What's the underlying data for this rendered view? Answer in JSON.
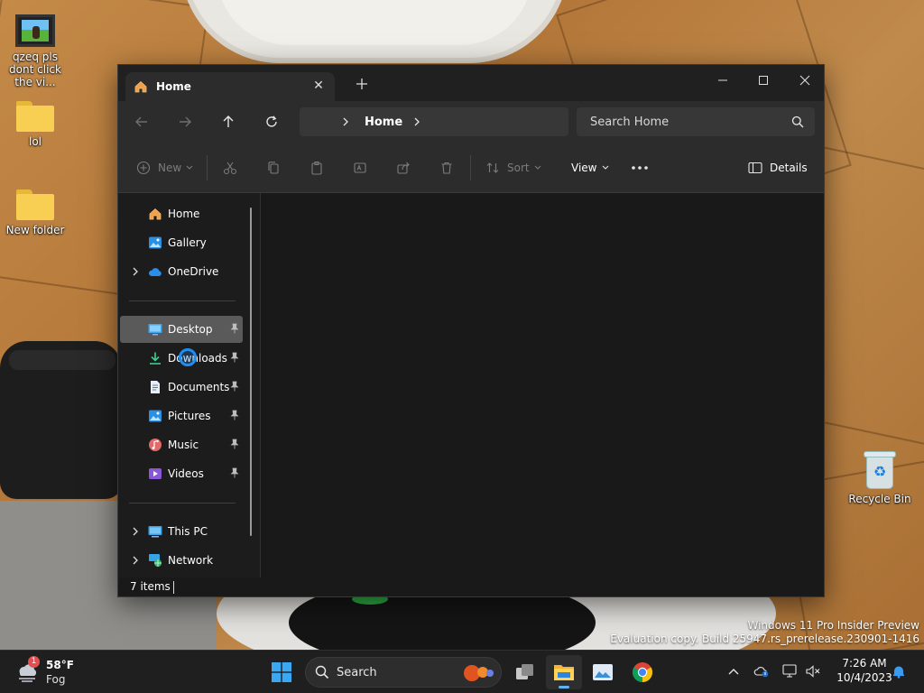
{
  "desktop": {
    "icons": [
      {
        "label": "qzeq pls dont click the vi..."
      },
      {
        "label": "lol"
      },
      {
        "label": "New folder"
      },
      {
        "label": "Recycle Bin"
      }
    ],
    "watermark": {
      "line1": "Windows 11 Pro Insider Preview",
      "line2": "Evaluation copy. Build 25947.rs_prerelease.230901-1416"
    }
  },
  "explorer": {
    "tab": {
      "label": "Home"
    },
    "window_controls": {
      "minimize": "minimize-icon",
      "maximize": "maximize-icon",
      "close": "close-icon"
    },
    "address": {
      "crumb": "Home"
    },
    "search": {
      "placeholder": "Search Home"
    },
    "commands": {
      "new_label": "New",
      "sort_label": "Sort",
      "view_label": "View",
      "details_label": "Details"
    },
    "nav": {
      "items": [
        {
          "label": "Home"
        },
        {
          "label": "Gallery"
        },
        {
          "label": "OneDrive"
        },
        {
          "label": "Desktop"
        },
        {
          "label": "Downloads"
        },
        {
          "label": "Documents"
        },
        {
          "label": "Pictures"
        },
        {
          "label": "Music"
        },
        {
          "label": "Videos"
        },
        {
          "label": "This PC"
        },
        {
          "label": "Network"
        }
      ]
    },
    "status": {
      "items_text": "7 items"
    }
  },
  "taskbar": {
    "weather": {
      "temp": "58°F",
      "condition": "Fog",
      "badge": "1"
    },
    "search_label": "Search",
    "clock": {
      "time": "7:26 AM",
      "date": "10/4/2023"
    }
  },
  "colors": {
    "accent": "#5eb3f0",
    "window_bg": "#191919",
    "toolbar_bg": "#2c2c2c",
    "selection": "#5a5a5a"
  }
}
